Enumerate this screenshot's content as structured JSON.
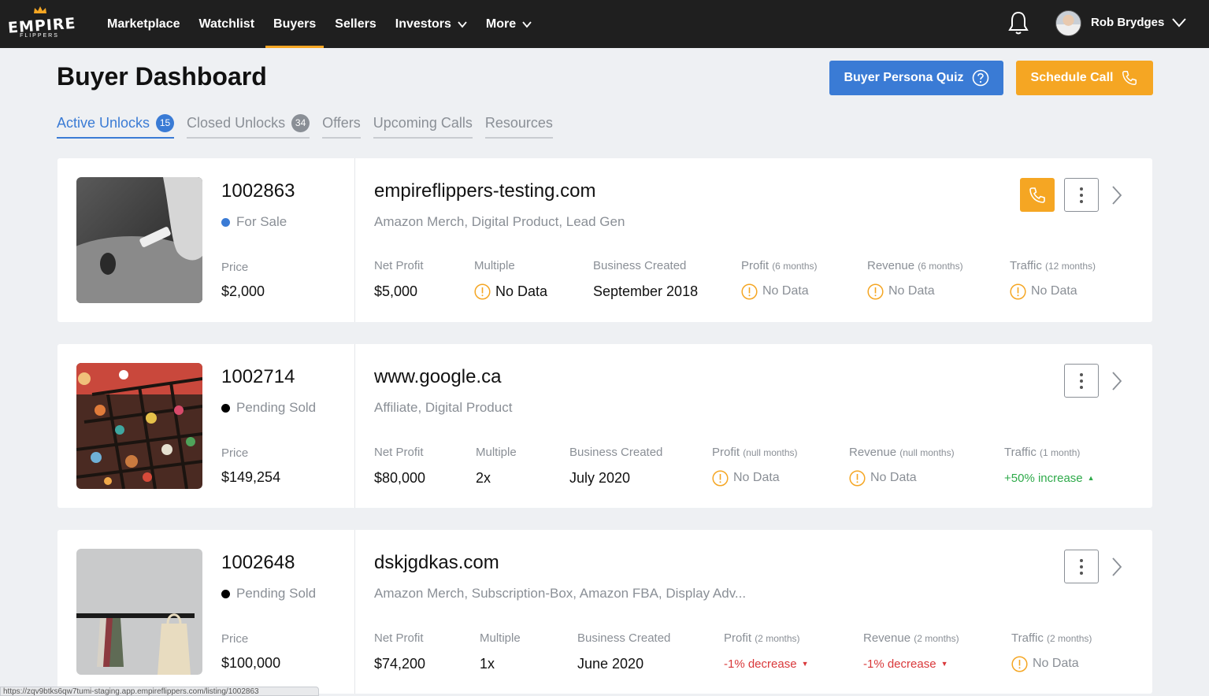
{
  "nav": {
    "logo_word": "EMPIRE",
    "logo_sub": "FLIPPERS",
    "items": [
      {
        "label": "Marketplace"
      },
      {
        "label": "Watchlist"
      },
      {
        "label": "Buyers",
        "active": true
      },
      {
        "label": "Sellers"
      },
      {
        "label": "Investors",
        "dropdown": true
      },
      {
        "label": "More",
        "dropdown": true
      }
    ],
    "user_name": "Rob Brydges"
  },
  "header": {
    "title": "Buyer Dashboard",
    "quiz_label": "Buyer Persona Quiz",
    "call_label": "Schedule Call"
  },
  "tabs": [
    {
      "label": "Active Unlocks",
      "count": "15",
      "active": true
    },
    {
      "label": "Closed Unlocks",
      "count": "34"
    },
    {
      "label": "Offers"
    },
    {
      "label": "Upcoming Calls"
    },
    {
      "label": "Resources"
    }
  ],
  "listings": [
    {
      "id": "1002863",
      "status": "For Sale",
      "status_color": "#3a7bd5",
      "price_label": "Price",
      "price": "$2,000",
      "site": "empireflippers-testing.com",
      "categories": "Amazon Merch, Digital Product, Lead Gen",
      "metrics": {
        "net_profit": {
          "label": "Net Profit",
          "value": "$5,000"
        },
        "multiple": {
          "label": "Multiple",
          "value": "No Data"
        },
        "created": {
          "label": "Business Created",
          "value": "September 2018"
        },
        "profit": {
          "label": "Profit",
          "period": "(6 months)",
          "value": "No Data"
        },
        "revenue": {
          "label": "Revenue",
          "period": "(6 months)",
          "value": "No Data"
        },
        "traffic": {
          "label": "Traffic",
          "period": "(12 months)",
          "value": "No Data"
        }
      }
    },
    {
      "id": "1002714",
      "status": "Pending Sold",
      "status_color": "#000000",
      "price_label": "Price",
      "price": "$149,254",
      "site": "www.google.ca",
      "categories": "Affiliate, Digital Product",
      "metrics": {
        "net_profit": {
          "label": "Net Profit",
          "value": "$80,000"
        },
        "multiple": {
          "label": "Multiple",
          "value": "2x"
        },
        "created": {
          "label": "Business Created",
          "value": "July 2020"
        },
        "profit": {
          "label": "Profit",
          "period": "(null months)",
          "value": "No Data"
        },
        "revenue": {
          "label": "Revenue",
          "period": "(null months)",
          "value": "No Data"
        },
        "traffic": {
          "label": "Traffic",
          "period": "(1 month)",
          "value": "+50% increase"
        }
      }
    },
    {
      "id": "1002648",
      "status": "Pending Sold",
      "status_color": "#000000",
      "price_label": "Price",
      "price": "$100,000",
      "site": "dskjgdkas.com",
      "categories": "Amazon Merch, Subscription-Box, Amazon FBA, Display Adv...",
      "metrics": {
        "net_profit": {
          "label": "Net Profit",
          "value": "$74,200"
        },
        "multiple": {
          "label": "Multiple",
          "value": "1x"
        },
        "created": {
          "label": "Business Created",
          "value": "June 2020"
        },
        "profit": {
          "label": "Profit",
          "period": "(2 months)",
          "value": "-1% decrease"
        },
        "revenue": {
          "label": "Revenue",
          "period": "(2 months)",
          "value": "-1% decrease"
        },
        "traffic": {
          "label": "Traffic",
          "period": "(2 months)",
          "value": "No Data"
        }
      }
    }
  ],
  "status_url": "https://zqv9btks6qw7tumi-staging.app.empireflippers.com/listing/1002863",
  "colors": {
    "accent_blue": "#3a7bd5",
    "accent_orange": "#f5a623",
    "up": "#2eaa4a",
    "down": "#d9383a"
  }
}
